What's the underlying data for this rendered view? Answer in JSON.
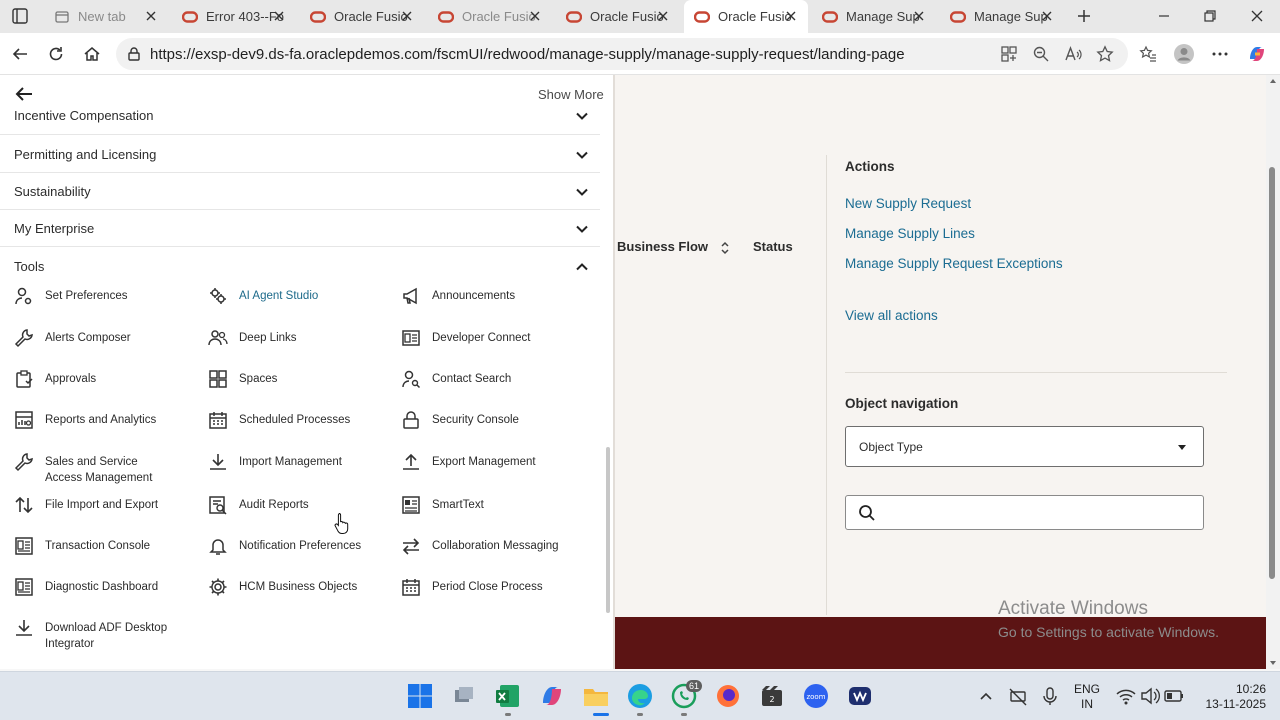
{
  "browser": {
    "tabs": [
      {
        "title": "New tab",
        "icon": "tab-pages-icon",
        "active": false,
        "dim": true
      },
      {
        "title": "Error 403--Fo",
        "icon": "oracle-icon",
        "active": false,
        "dim": false
      },
      {
        "title": "Oracle Fusio",
        "icon": "oracle-icon",
        "active": false,
        "dim": false
      },
      {
        "title": "Oracle Fusio",
        "icon": "oracle-icon",
        "active": false,
        "dim": true
      },
      {
        "title": "Oracle Fusio",
        "icon": "oracle-icon",
        "active": false,
        "dim": false
      },
      {
        "title": "Oracle Fusio",
        "icon": "oracle-icon",
        "active": true,
        "dim": false
      },
      {
        "title": "Manage Sup",
        "icon": "oracle-icon",
        "active": false,
        "dim": false
      },
      {
        "title": "Manage Sup",
        "icon": "oracle-icon",
        "active": false,
        "dim": false
      }
    ],
    "url": "https://exsp-dev9.ds-fa.oraclepdemos.com/fscmUI/redwood/manage-supply/manage-supply-request/landing-page"
  },
  "navigator": {
    "show_more": "Show More",
    "sections": [
      {
        "label": "Incentive Compensation",
        "expanded": false
      },
      {
        "label": "Permitting and Licensing",
        "expanded": false
      },
      {
        "label": "Sustainability",
        "expanded": false
      },
      {
        "label": "My Enterprise",
        "expanded": false
      },
      {
        "label": "Tools",
        "expanded": true
      }
    ],
    "tools": [
      {
        "label": "Set Preferences",
        "icon": "user-settings-icon"
      },
      {
        "label": "AI Agent Studio",
        "icon": "ai-gears-icon",
        "accent": true
      },
      {
        "label": "Announcements",
        "icon": "megaphone-icon"
      },
      {
        "label": "Alerts Composer",
        "icon": "wrench-icon"
      },
      {
        "label": "Deep Links",
        "icon": "users-icon"
      },
      {
        "label": "Developer Connect",
        "icon": "developer-icon"
      },
      {
        "label": "Approvals",
        "icon": "clipboard-icon"
      },
      {
        "label": "Spaces",
        "icon": "grid-icon"
      },
      {
        "label": "Contact Search",
        "icon": "person-search-icon"
      },
      {
        "label": "Reports and Analytics",
        "icon": "report-icon"
      },
      {
        "label": "Scheduled Processes",
        "icon": "calendar-icon"
      },
      {
        "label": "Security Console",
        "icon": "lock-icon"
      },
      {
        "label": "Sales and Service Access Management",
        "icon": "wrench-icon"
      },
      {
        "label": "Import Management",
        "icon": "download-icon"
      },
      {
        "label": "Export Management",
        "icon": "upload-icon"
      },
      {
        "label": "File Import and Export",
        "icon": "transfer-icon"
      },
      {
        "label": "Audit Reports",
        "icon": "audit-icon"
      },
      {
        "label": "SmartText",
        "icon": "document-icon"
      },
      {
        "label": "Transaction Console",
        "icon": "console-icon"
      },
      {
        "label": "Notification Preferences",
        "icon": "bell-icon"
      },
      {
        "label": "Collaboration Messaging",
        "icon": "exchange-icon"
      },
      {
        "label": "Diagnostic Dashboard",
        "icon": "dashboard-icon"
      },
      {
        "label": "HCM Business Objects",
        "icon": "gear-icon"
      },
      {
        "label": "Period Close Process",
        "icon": "calendar-icon"
      },
      {
        "label": "Download ADF Desktop Integrator",
        "icon": "download-icon"
      }
    ]
  },
  "page": {
    "columns": [
      "Business Flow",
      "Status"
    ],
    "actions_title": "Actions",
    "actions": [
      "New Supply Request",
      "Manage Supply Lines",
      "Manage Supply Request Exceptions"
    ],
    "view_all": "View all actions",
    "object_nav_title": "Object navigation",
    "object_type": "Object Type",
    "watermark_title": "Activate Windows",
    "watermark_sub": "Go to Settings to activate Windows."
  },
  "taskbar": {
    "whatsapp_badge": "61",
    "lang": "ENG",
    "region": "IN",
    "time": "10:26",
    "date": "13-11-2025"
  },
  "colors": {
    "accent_link": "#1b6c92",
    "banner": "#5c1414",
    "oracle_red": "#c74634"
  }
}
